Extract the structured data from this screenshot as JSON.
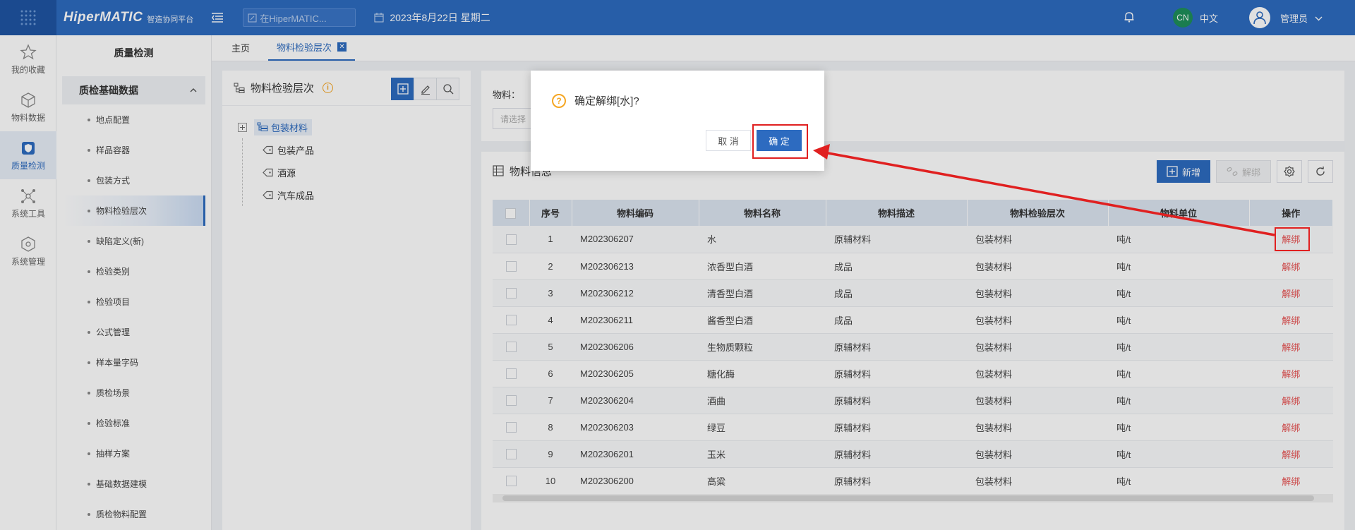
{
  "topbar": {
    "brand": "HiperMATIC",
    "brand_sub": "智造协同平台",
    "search_placeholder": "在HiperMATIC...",
    "date": "2023年8月22日 星期二",
    "lang_code": "CN",
    "lang_label": "中文",
    "user": "管理员",
    "colors": {
      "primary": "#2d6bc0",
      "danger": "#e85050",
      "warning": "#f5a623"
    }
  },
  "rail": [
    {
      "label": "我的收藏",
      "icon": "star-icon"
    },
    {
      "label": "物料数据",
      "icon": "cube-icon"
    },
    {
      "label": "质量检测",
      "icon": "shield-icon",
      "active": true
    },
    {
      "label": "系统工具",
      "icon": "nodes-icon"
    },
    {
      "label": "系统管理",
      "icon": "box-icon"
    }
  ],
  "sidebar": {
    "title": "质量检测",
    "group": "质检基础数据",
    "items": [
      "地点配置",
      "样品容器",
      "包装方式",
      "物料检验层次",
      "缺陷定义(新)",
      "检验类别",
      "检验项目",
      "公式管理",
      "样本量字码",
      "质检场景",
      "检验标准",
      "抽样方案",
      "基础数据建模",
      "质检物料配置"
    ],
    "active_index": 3
  },
  "tabs": [
    {
      "label": "主页"
    },
    {
      "label": "物料检验层次",
      "active": true
    }
  ],
  "left_panel": {
    "title": "物料检验层次",
    "tree_root": "包装材料",
    "tree_children": [
      "包装产品",
      "酒源",
      "汽车成品"
    ]
  },
  "filter": {
    "label": "物料：",
    "placeholder": "请选择"
  },
  "table_panel": {
    "title": "物料信息",
    "add_label": "新增",
    "unbind_label": "解绑",
    "columns": [
      "序号",
      "物料编码",
      "物料名称",
      "物料描述",
      "物料检验层次",
      "物料单位",
      "操作"
    ],
    "rows": [
      {
        "no": "1",
        "code": "M202306207",
        "name": "水",
        "desc": "原辅材料",
        "level": "包装材料",
        "unit": "吨/t",
        "op": "解绑"
      },
      {
        "no": "2",
        "code": "M202306213",
        "name": "浓香型白酒",
        "desc": "成品",
        "level": "包装材料",
        "unit": "吨/t",
        "op": "解绑"
      },
      {
        "no": "3",
        "code": "M202306212",
        "name": "清香型白酒",
        "desc": "成品",
        "level": "包装材料",
        "unit": "吨/t",
        "op": "解绑"
      },
      {
        "no": "4",
        "code": "M202306211",
        "name": "酱香型白酒",
        "desc": "成品",
        "level": "包装材料",
        "unit": "吨/t",
        "op": "解绑"
      },
      {
        "no": "5",
        "code": "M202306206",
        "name": "生物质颗粒",
        "desc": "原辅材料",
        "level": "包装材料",
        "unit": "吨/t",
        "op": "解绑"
      },
      {
        "no": "6",
        "code": "M202306205",
        "name": "糖化酶",
        "desc": "原辅材料",
        "level": "包装材料",
        "unit": "吨/t",
        "op": "解绑"
      },
      {
        "no": "7",
        "code": "M202306204",
        "name": "酒曲",
        "desc": "原辅材料",
        "level": "包装材料",
        "unit": "吨/t",
        "op": "解绑"
      },
      {
        "no": "8",
        "code": "M202306203",
        "name": "绿豆",
        "desc": "原辅材料",
        "level": "包装材料",
        "unit": "吨/t",
        "op": "解绑"
      },
      {
        "no": "9",
        "code": "M202306201",
        "name": "玉米",
        "desc": "原辅材料",
        "level": "包装材料",
        "unit": "吨/t",
        "op": "解绑"
      },
      {
        "no": "10",
        "code": "M202306200",
        "name": "高粱",
        "desc": "原辅材料",
        "level": "包装材料",
        "unit": "吨/t",
        "op": "解绑"
      }
    ]
  },
  "dialog": {
    "message": "确定解绑[水]?",
    "cancel": "取 消",
    "ok": "确 定"
  }
}
